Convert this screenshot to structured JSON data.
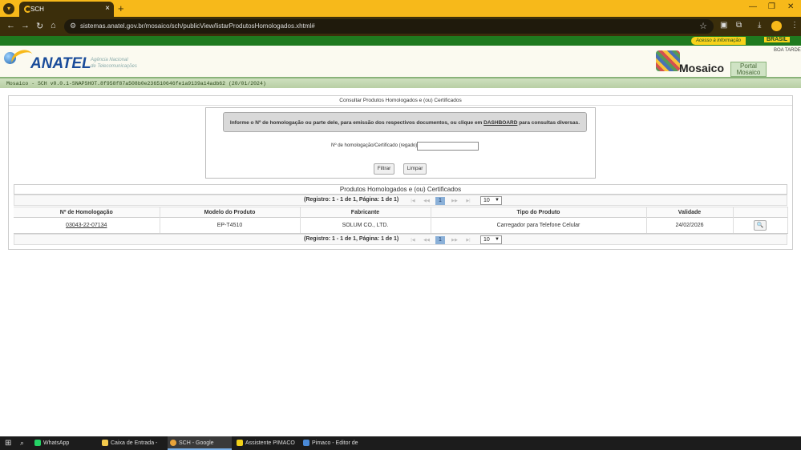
{
  "browser": {
    "tab_title": "SCH",
    "url": "sistemas.anatel.gov.br/mosaico/sch/publicView/listarProdutosHomologados.xhtml#",
    "new_tab": "+",
    "minimize": "—",
    "maximize": "❐",
    "close": "✕"
  },
  "gov_bar": {
    "acesso": "Acesso à informação",
    "brasil": "BRASIL"
  },
  "header": {
    "anatel": "ANATEL",
    "agencia_line1": "Agência Nacional",
    "agencia_line2": "de Telecomunicações",
    "mosaico": "Mosaico",
    "portal_line1": "Portal",
    "portal_line2": "Mosaico",
    "greeting": "BOA TARDE"
  },
  "version": "Mosaico - SCH  v0.0.1-SNAPSHOT.8f958f87a508b0e236510646fe1a9139a14adb62 (20/01/2024)",
  "search": {
    "panel_title": "Consultar Produtos Homologados e (ou) Certificados",
    "info_before": "Informe o Nº de homologação ou parte dele, para emissão dos respectivos documentos, ou clique em ",
    "info_link": "DASHBOARD",
    "info_after": " para consultas diversas.",
    "field_label": "Nº de homologação/Certificado (regado):",
    "field_value": "",
    "filter_button": "Filtrar",
    "clear_button": "Limpar"
  },
  "results": {
    "title": "Produtos Homologados e (ou) Certificados",
    "pager_text": "(Registro: 1 - 1 de 1, Página: 1 de 1)",
    "pager_first": "|◀",
    "pager_prev": "◀◀",
    "pager_next": "▶▶",
    "pager_last": "▶|",
    "current_page": "1",
    "rows_per_page": "10",
    "columns": [
      "Nº de Homologação",
      "Modelo do Produto",
      "Fabricante",
      "Tipo do Produto",
      "Validade",
      ""
    ],
    "rows": [
      {
        "homologacao": "03043-22-07134",
        "modelo": "EP-T4510",
        "fabricante": "SOLUM CO., LTD.",
        "tipo": "Carregador para Telefone Celular",
        "validade": "24/02/2026"
      }
    ]
  },
  "taskbar": {
    "items": [
      "WhatsApp",
      "Caixa de Entrada - wil...",
      "SCH - Google Chrome",
      "Assistente PIMACO",
      "Pimaco - Editor de Eti..."
    ]
  },
  "colors": {
    "chrome_frame": "#f7b91a",
    "chrome_toolbar": "#3b2e0b",
    "gov_green": "#1f7a1f",
    "anatel_blue": "#1a4c9a"
  }
}
